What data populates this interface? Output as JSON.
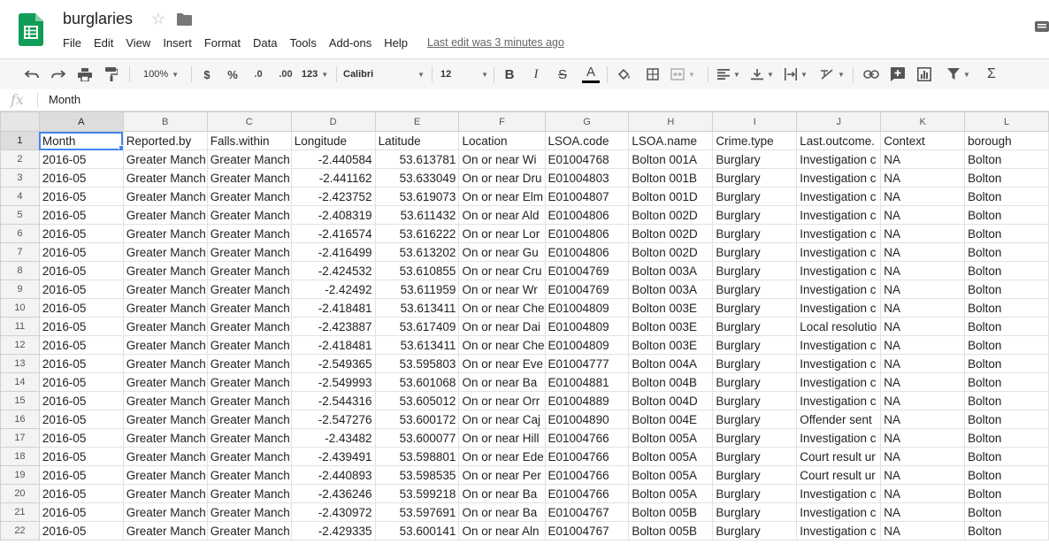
{
  "app": {
    "title": "burglaries",
    "last_edit": "Last edit was 3 minutes ago",
    "brand_color": "#0f9d58"
  },
  "menu": [
    "File",
    "Edit",
    "View",
    "Insert",
    "Format",
    "Data",
    "Tools",
    "Add-ons",
    "Help"
  ],
  "toolbar": {
    "zoom": "100%",
    "currency": "$",
    "percent": "%",
    "decrease_decimals": ".0",
    "increase_decimals": ".00",
    "more_formats": "123",
    "font": "Calibri",
    "font_size": "12",
    "bold": "B",
    "italic": "I",
    "strikethrough": "S",
    "text_color": "A",
    "functions": "Σ"
  },
  "formula_bar": {
    "fx_label": "fx",
    "value": "Month"
  },
  "columns": [
    "A",
    "B",
    "C",
    "D",
    "E",
    "F",
    "G",
    "H",
    "I",
    "J",
    "K",
    "L"
  ],
  "header_row": [
    "Month",
    "Reported.by",
    "Falls.within",
    "Longitude",
    "Latitude",
    "Location",
    "LSOA.code",
    "LSOA.name",
    "Crime.type",
    "Last.outcome.",
    "Context",
    "borough"
  ],
  "rows": [
    [
      "2016-05",
      "Greater Manch",
      "Greater Manch",
      "-2.440584",
      "53.613781",
      "On or near Wi",
      "E01004768",
      "Bolton 001A",
      "Burglary",
      "Investigation c",
      "NA",
      "Bolton"
    ],
    [
      "2016-05",
      "Greater Manch",
      "Greater Manch",
      "-2.441162",
      "53.633049",
      "On or near Dru",
      "E01004803",
      "Bolton 001B",
      "Burglary",
      "Investigation c",
      "NA",
      "Bolton"
    ],
    [
      "2016-05",
      "Greater Manch",
      "Greater Manch",
      "-2.423752",
      "53.619073",
      "On or near Elm",
      "E01004807",
      "Bolton 001D",
      "Burglary",
      "Investigation c",
      "NA",
      "Bolton"
    ],
    [
      "2016-05",
      "Greater Manch",
      "Greater Manch",
      "-2.408319",
      "53.611432",
      "On or near Ald",
      "E01004806",
      "Bolton 002D",
      "Burglary",
      "Investigation c",
      "NA",
      "Bolton"
    ],
    [
      "2016-05",
      "Greater Manch",
      "Greater Manch",
      "-2.416574",
      "53.616222",
      "On or near Lor",
      "E01004806",
      "Bolton 002D",
      "Burglary",
      "Investigation c",
      "NA",
      "Bolton"
    ],
    [
      "2016-05",
      "Greater Manch",
      "Greater Manch",
      "-2.416499",
      "53.613202",
      "On or near Gu",
      "E01004806",
      "Bolton 002D",
      "Burglary",
      "Investigation c",
      "NA",
      "Bolton"
    ],
    [
      "2016-05",
      "Greater Manch",
      "Greater Manch",
      "-2.424532",
      "53.610855",
      "On or near Cru",
      "E01004769",
      "Bolton 003A",
      "Burglary",
      "Investigation c",
      "NA",
      "Bolton"
    ],
    [
      "2016-05",
      "Greater Manch",
      "Greater Manch",
      "-2.42492",
      "53.611959",
      "On or near Wr",
      "E01004769",
      "Bolton 003A",
      "Burglary",
      "Investigation c",
      "NA",
      "Bolton"
    ],
    [
      "2016-05",
      "Greater Manch",
      "Greater Manch",
      "-2.418481",
      "53.613411",
      "On or near Che",
      "E01004809",
      "Bolton 003E",
      "Burglary",
      "Investigation c",
      "NA",
      "Bolton"
    ],
    [
      "2016-05",
      "Greater Manch",
      "Greater Manch",
      "-2.423887",
      "53.617409",
      "On or near Dai",
      "E01004809",
      "Bolton 003E",
      "Burglary",
      "Local resolutio",
      "NA",
      "Bolton"
    ],
    [
      "2016-05",
      "Greater Manch",
      "Greater Manch",
      "-2.418481",
      "53.613411",
      "On or near Che",
      "E01004809",
      "Bolton 003E",
      "Burglary",
      "Investigation c",
      "NA",
      "Bolton"
    ],
    [
      "2016-05",
      "Greater Manch",
      "Greater Manch",
      "-2.549365",
      "53.595803",
      "On or near Eve",
      "E01004777",
      "Bolton 004A",
      "Burglary",
      "Investigation c",
      "NA",
      "Bolton"
    ],
    [
      "2016-05",
      "Greater Manch",
      "Greater Manch",
      "-2.549993",
      "53.601068",
      "On or near Ba",
      "E01004881",
      "Bolton 004B",
      "Burglary",
      "Investigation c",
      "NA",
      "Bolton"
    ],
    [
      "2016-05",
      "Greater Manch",
      "Greater Manch",
      "-2.544316",
      "53.605012",
      "On or near Orr",
      "E01004889",
      "Bolton 004D",
      "Burglary",
      "Investigation c",
      "NA",
      "Bolton"
    ],
    [
      "2016-05",
      "Greater Manch",
      "Greater Manch",
      "-2.547276",
      "53.600172",
      "On or near Caj",
      "E01004890",
      "Bolton 004E",
      "Burglary",
      "Offender sent",
      "NA",
      "Bolton"
    ],
    [
      "2016-05",
      "Greater Manch",
      "Greater Manch",
      "-2.43482",
      "53.600077",
      "On or near Hill",
      "E01004766",
      "Bolton 005A",
      "Burglary",
      "Investigation c",
      "NA",
      "Bolton"
    ],
    [
      "2016-05",
      "Greater Manch",
      "Greater Manch",
      "-2.439491",
      "53.598801",
      "On or near Ede",
      "E01004766",
      "Bolton 005A",
      "Burglary",
      "Court result ur",
      "NA",
      "Bolton"
    ],
    [
      "2016-05",
      "Greater Manch",
      "Greater Manch",
      "-2.440893",
      "53.598535",
      "On or near Per",
      "E01004766",
      "Bolton 005A",
      "Burglary",
      "Court result ur",
      "NA",
      "Bolton"
    ],
    [
      "2016-05",
      "Greater Manch",
      "Greater Manch",
      "-2.436246",
      "53.599218",
      "On or near Ba",
      "E01004766",
      "Bolton 005A",
      "Burglary",
      "Investigation c",
      "NA",
      "Bolton"
    ],
    [
      "2016-05",
      "Greater Manch",
      "Greater Manch",
      "-2.430972",
      "53.597691",
      "On or near Ba",
      "E01004767",
      "Bolton 005B",
      "Burglary",
      "Investigation c",
      "NA",
      "Bolton"
    ],
    [
      "2016-05",
      "Greater Manch",
      "Greater Manch",
      "-2.429335",
      "53.600141",
      "On or near Aln",
      "E01004767",
      "Bolton 005B",
      "Burglary",
      "Investigation c",
      "NA",
      "Bolton"
    ]
  ]
}
